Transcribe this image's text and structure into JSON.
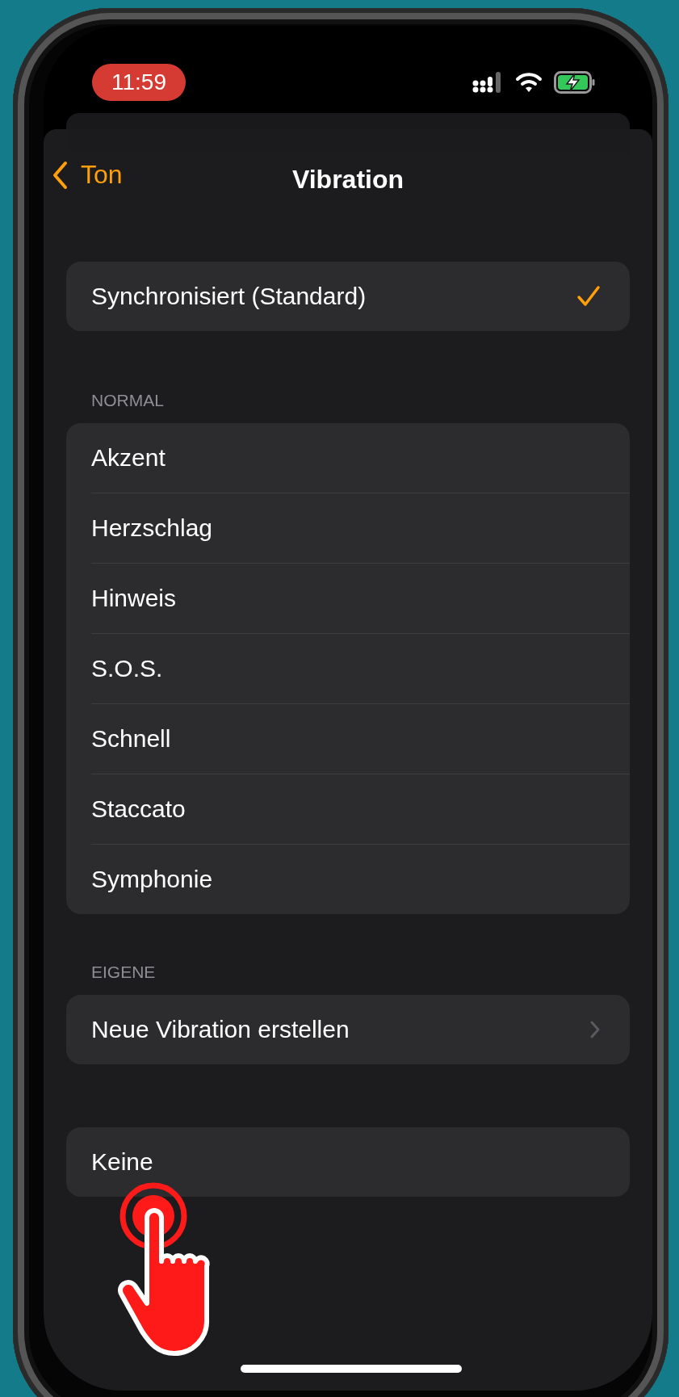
{
  "status_bar": {
    "time": "11:59"
  },
  "nav": {
    "back": "Ton",
    "title": "Vibration"
  },
  "sections": [
    {
      "rows": [
        {
          "label": "Synchronisiert (Standard)",
          "kind": "check",
          "selected": true
        }
      ]
    },
    {
      "header": "NORMAL",
      "rows": [
        {
          "label": "Akzent",
          "kind": "check",
          "selected": false
        },
        {
          "label": "Herzschlag",
          "kind": "check",
          "selected": false
        },
        {
          "label": "Hinweis",
          "kind": "check",
          "selected": false
        },
        {
          "label": "S.O.S.",
          "kind": "check",
          "selected": false
        },
        {
          "label": "Schnell",
          "kind": "check",
          "selected": false
        },
        {
          "label": "Staccato",
          "kind": "check",
          "selected": false
        },
        {
          "label": "Symphonie",
          "kind": "check",
          "selected": false
        }
      ]
    },
    {
      "header": "EIGENE",
      "rows": [
        {
          "label": "Neue Vibration erstellen",
          "kind": "link"
        }
      ]
    },
    {
      "rows": [
        {
          "label": "Keine",
          "kind": "check",
          "selected": false
        }
      ]
    }
  ]
}
